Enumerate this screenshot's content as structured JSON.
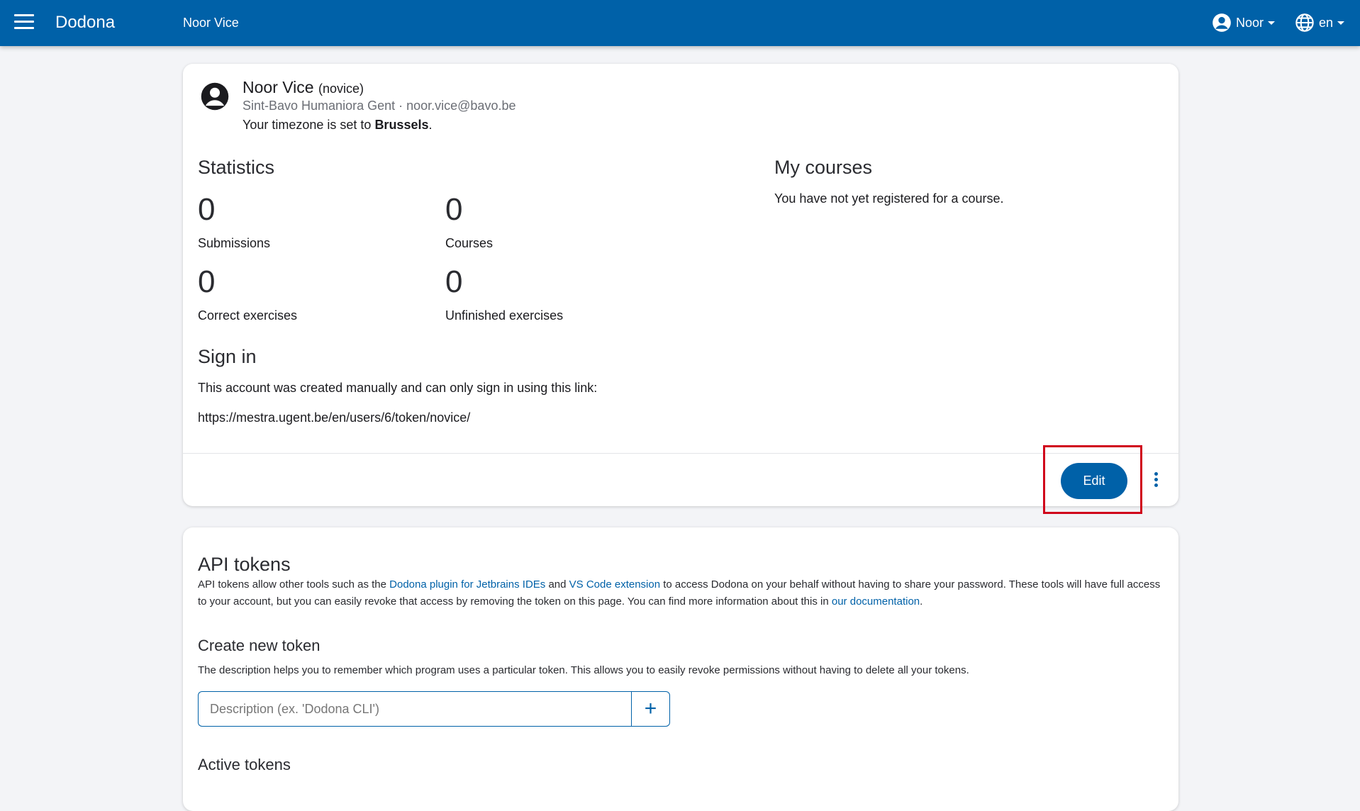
{
  "header": {
    "brand": "Dodona",
    "breadcrumb": "Noor Vice",
    "user_menu_label": "Noor",
    "language_label": "en"
  },
  "profile": {
    "name": "Noor Vice",
    "role": "(novice)",
    "school_email": "Sint-Bavo Humaniora Gent · noor.vice@bavo.be",
    "timezone_prefix": "Your timezone is set to ",
    "timezone_value": "Brussels",
    "timezone_suffix": "."
  },
  "statistics": {
    "title": "Statistics",
    "items": [
      {
        "value": "0",
        "label": "Submissions"
      },
      {
        "value": "0",
        "label": "Courses"
      },
      {
        "value": "0",
        "label": "Correct exercises"
      },
      {
        "value": "0",
        "label": "Unfinished exercises"
      }
    ]
  },
  "courses": {
    "title": "My courses",
    "empty_text": "You have not yet registered for a course."
  },
  "signin": {
    "title": "Sign in",
    "description": "This account was created manually and can only sign in using this link:",
    "link": "https://mestra.ugent.be/en/users/6/token/novice/"
  },
  "actions": {
    "edit_label": "Edit"
  },
  "api_tokens": {
    "title": "API tokens",
    "desc_1": "API tokens allow other tools such as the ",
    "link_jetbrains": "Dodona plugin for Jetbrains IDEs",
    "desc_2": " and ",
    "link_vscode": "VS Code extension",
    "desc_3": " to access Dodona on your behalf without having to share your password. These tools will have full access to your account, but you can easily revoke that access by removing the token on this page. You can find more information about this in ",
    "link_docs": "our documentation",
    "desc_4": ".",
    "create_title": "Create new token",
    "create_desc": "The description helps you to remember which program uses a particular token. This allows you to easily revoke permissions without having to delete all your tokens.",
    "input_placeholder": "Description (ex. 'Dodona CLI')",
    "add_label": "+",
    "active_title": "Active tokens"
  },
  "colors": {
    "primary": "#0061a8",
    "highlight": "#d0021b"
  }
}
